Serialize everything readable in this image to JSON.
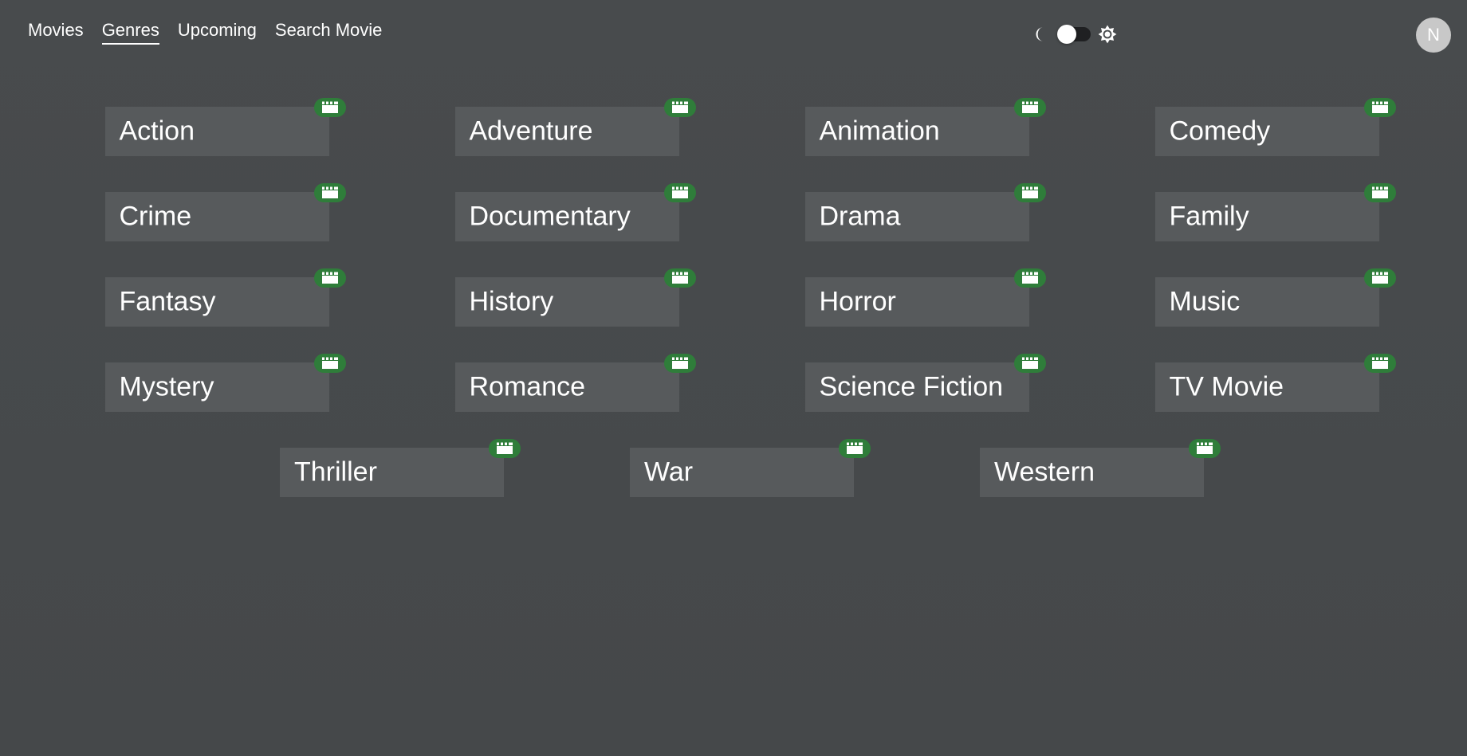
{
  "nav": {
    "links": [
      {
        "label": "Movies",
        "active": false
      },
      {
        "label": "Genres",
        "active": true
      },
      {
        "label": "Upcoming",
        "active": false
      },
      {
        "label": "Search Movie",
        "active": false
      }
    ]
  },
  "theme_toggle": {
    "left_icon": "moon-icon",
    "right_icon": "sun-icon",
    "state": "dark"
  },
  "avatar": {
    "initial": "N"
  },
  "colors": {
    "background": "#484b4d",
    "card": "#575a5c",
    "badge": "#2f7d3a",
    "text": "#ffffff"
  },
  "genres": [
    {
      "label": "Action",
      "icon": "clapperboard-icon"
    },
    {
      "label": "Adventure",
      "icon": "clapperboard-icon"
    },
    {
      "label": "Animation",
      "icon": "clapperboard-icon"
    },
    {
      "label": "Comedy",
      "icon": "clapperboard-icon"
    },
    {
      "label": "Crime",
      "icon": "clapperboard-icon"
    },
    {
      "label": "Documentary",
      "icon": "clapperboard-icon"
    },
    {
      "label": "Drama",
      "icon": "clapperboard-icon"
    },
    {
      "label": "Family",
      "icon": "clapperboard-icon"
    },
    {
      "label": "Fantasy",
      "icon": "clapperboard-icon"
    },
    {
      "label": "History",
      "icon": "clapperboard-icon"
    },
    {
      "label": "Horror",
      "icon": "clapperboard-icon"
    },
    {
      "label": "Music",
      "icon": "clapperboard-icon"
    },
    {
      "label": "Mystery",
      "icon": "clapperboard-icon"
    },
    {
      "label": "Romance",
      "icon": "clapperboard-icon"
    },
    {
      "label": "Science Fiction",
      "icon": "clapperboard-icon"
    },
    {
      "label": "TV Movie",
      "icon": "clapperboard-icon"
    },
    {
      "label": "Thriller",
      "icon": "clapperboard-icon"
    },
    {
      "label": "War",
      "icon": "clapperboard-icon"
    },
    {
      "label": "Western",
      "icon": "clapperboard-icon"
    }
  ]
}
